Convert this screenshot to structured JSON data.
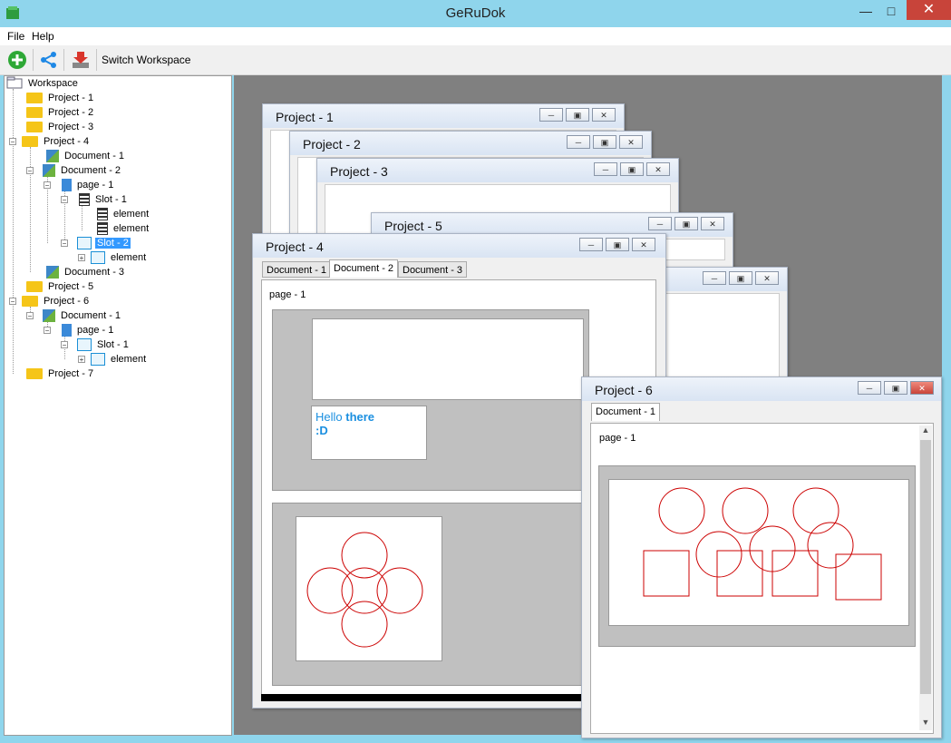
{
  "app": {
    "title": "GeRuDok"
  },
  "menu": {
    "file": "File",
    "help": "Help"
  },
  "toolbar": {
    "switch_workspace": "Switch Workspace"
  },
  "tree": {
    "workspace": "Workspace",
    "nodes": [
      "Project - 1",
      "Project - 2",
      "Project - 3",
      "Project - 4",
      "Document - 1",
      "Document - 2",
      "page - 1",
      "Slot - 1",
      "element",
      "element",
      "Slot - 2",
      "element",
      "Document - 3",
      "Project - 5",
      "Project - 6",
      "Document - 1",
      "page - 1",
      "Slot - 1",
      "element",
      "Project - 7"
    ]
  },
  "windows": {
    "p1": "Project - 1",
    "p2": "Project - 2",
    "p3": "Project - 3",
    "p5": "Project - 5",
    "p4": {
      "title": "Project - 4",
      "tabs": [
        "Document - 1",
        "Document - 2",
        "Document - 3"
      ],
      "page_label": "page - 1",
      "text_hello": "Hello",
      "text_there": "there",
      "text_smile": ":D"
    },
    "p6": {
      "title": "Project - 6",
      "tabs": [
        "Document - 1"
      ],
      "page_label": "page - 1"
    }
  },
  "colors": {
    "accent_select": "#3399ff",
    "shape_stroke": "#cc0000",
    "text_blue": "#1a8fe0"
  }
}
